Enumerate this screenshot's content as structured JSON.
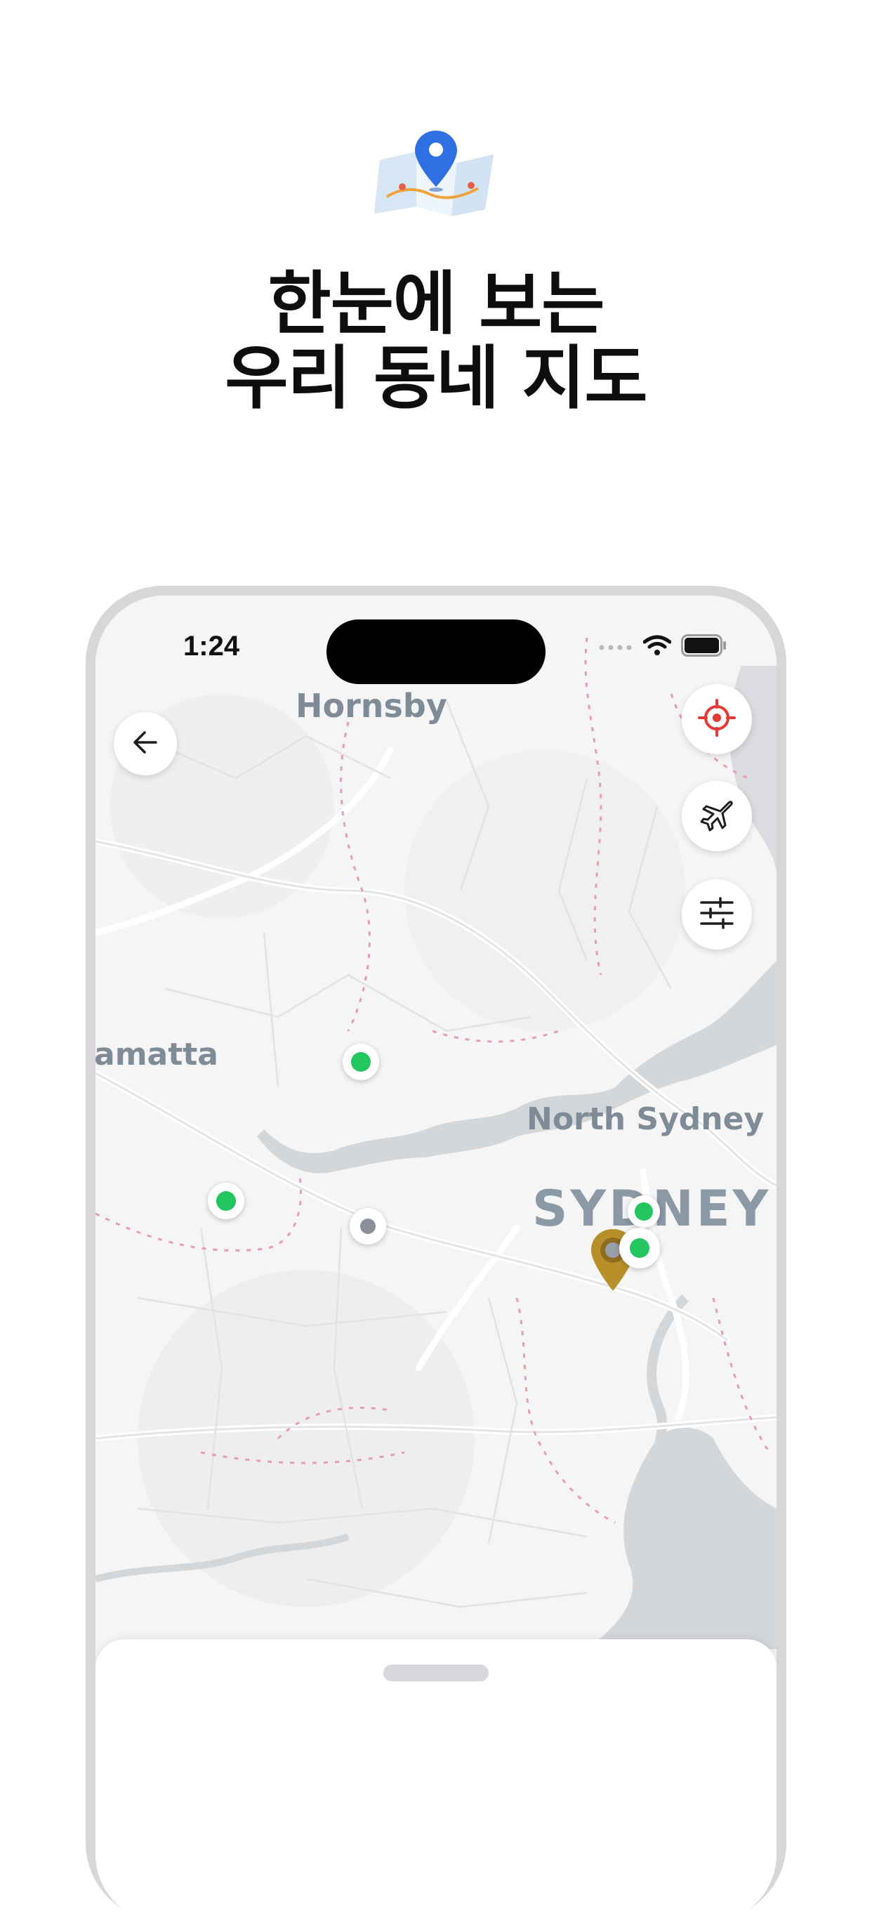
{
  "headline": {
    "line1": "한눈에 보는",
    "line2": "우리 동네 지도",
    "icon": "folded-map-pin-icon"
  },
  "status_bar": {
    "time": "1:24",
    "icons": [
      "signal-dots-icon",
      "wifi-icon",
      "battery-icon"
    ]
  },
  "map": {
    "labels": {
      "hornsby": "Hornsby",
      "parramatta": "amatta",
      "north_sydney": "North Sydney",
      "sydney": "SYDNEY"
    },
    "markers": [
      {
        "name": "marker-green",
        "color": "#22c55e"
      },
      {
        "name": "marker-green",
        "color": "#22c55e"
      },
      {
        "name": "marker-gray",
        "color": "#8c8f9a"
      },
      {
        "name": "marker-green",
        "color": "#22c55e"
      },
      {
        "name": "marker-green",
        "color": "#22c55e"
      },
      {
        "name": "current-location-pin",
        "color": "#b8902a"
      }
    ]
  },
  "controls": {
    "back": "arrow-left-icon",
    "locate": "crosshair-target-icon",
    "travel": "airplane-icon",
    "filter": "sliders-icon",
    "locate_color": "#e53935"
  },
  "colors": {
    "green_marker": "#22c55e",
    "gray_marker": "#8c8f9a",
    "pin_gold": "#b8902a",
    "boundary": "#e3a0a6",
    "water": "#d4d7da"
  }
}
